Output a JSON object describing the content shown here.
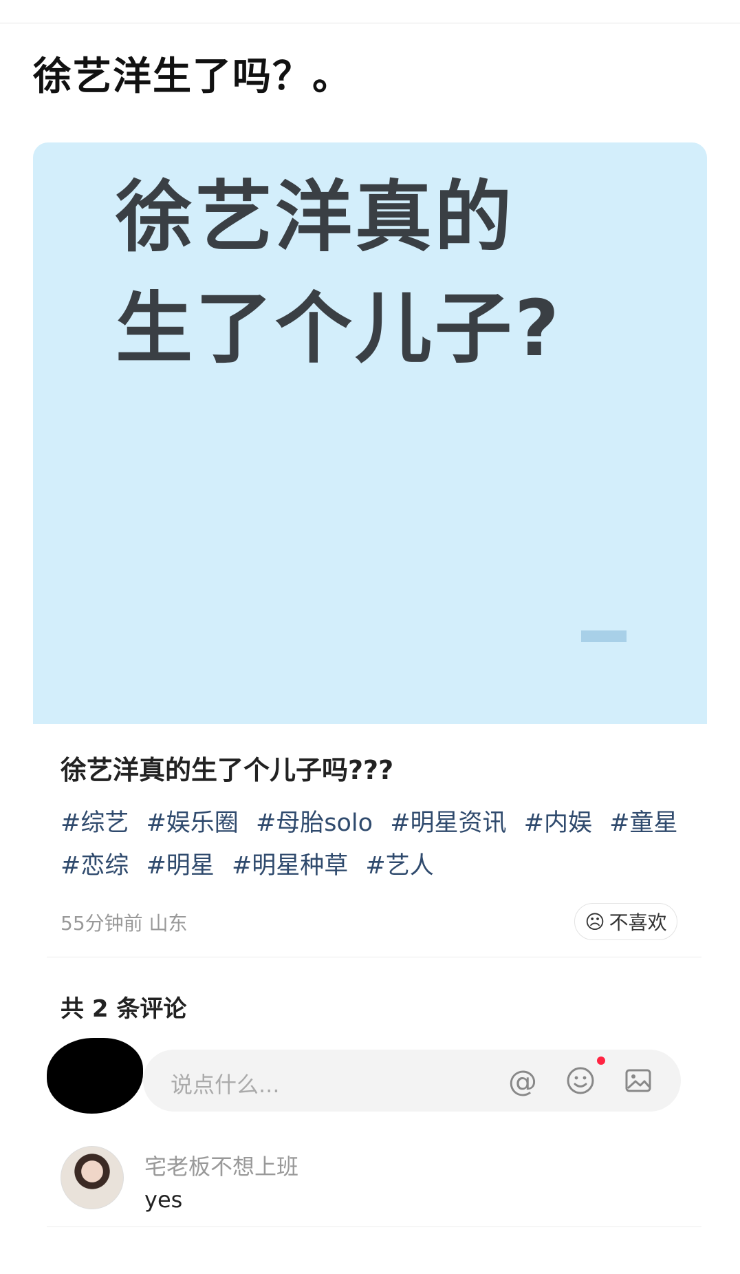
{
  "page": {
    "title": "徐艺洋生了吗？。"
  },
  "cover": {
    "line1": "徐艺洋真的",
    "line2": "生了个儿子?",
    "bg_color": "#d3eefb"
  },
  "post": {
    "title": "徐艺洋真的生了个儿子吗???",
    "tags": [
      "#综艺",
      "#娱乐圈",
      "#母胎solo",
      "#明星资讯",
      "#内娱",
      "#童星",
      "#恋综",
      "#明星",
      "#明星种草",
      "#艺人"
    ],
    "time": "55分钟前",
    "location": "山东",
    "dislike_label": "不喜欢",
    "tag_color": "#2f4a6d"
  },
  "comments": {
    "count_label": "共 2 条评论",
    "input_placeholder": "说点什么...",
    "input_icons": [
      "at-icon",
      "emoji-icon",
      "image-icon"
    ],
    "items": [
      {
        "author": "宅老板不想上班",
        "text": "yes"
      }
    ]
  }
}
